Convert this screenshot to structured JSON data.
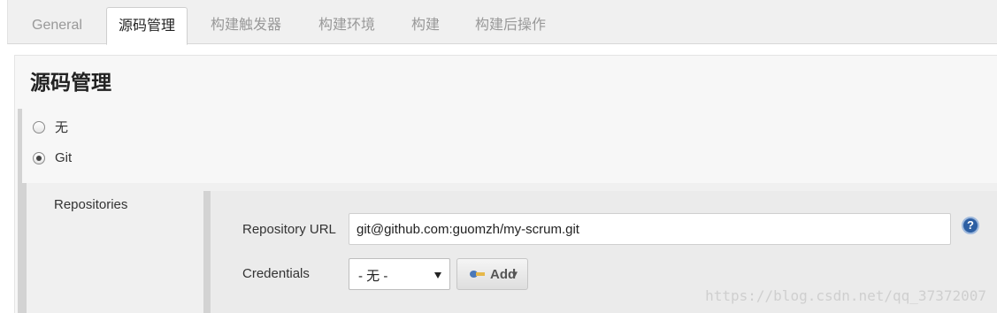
{
  "tabs": [
    {
      "label": "General",
      "active": false
    },
    {
      "label": "源码管理",
      "active": true
    },
    {
      "label": "构建触发器",
      "active": false
    },
    {
      "label": "构建环境",
      "active": false
    },
    {
      "label": "构建",
      "active": false
    },
    {
      "label": "构建后操作",
      "active": false
    }
  ],
  "section": {
    "title": "源码管理"
  },
  "scm_options": [
    {
      "label": "无",
      "checked": false
    },
    {
      "label": "Git",
      "checked": true
    }
  ],
  "git": {
    "repositories_label": "Repositories",
    "repo_url_label": "Repository URL",
    "repo_url_value": "git@github.com:guomzh/my-scrum.git",
    "credentials_label": "Credentials",
    "credentials_selected": "- 无 -",
    "add_button_label": "Add",
    "help_symbol": "?"
  },
  "watermark": "https://blog.csdn.net/qq_37372007",
  "icons": {
    "help": "help-icon",
    "key": "key-icon",
    "dropdown": "chevron-down-icon"
  },
  "colors": {
    "help_icon": "#2d5fa3",
    "active_tab_text": "#222222",
    "inactive_tab_text": "#999999"
  }
}
